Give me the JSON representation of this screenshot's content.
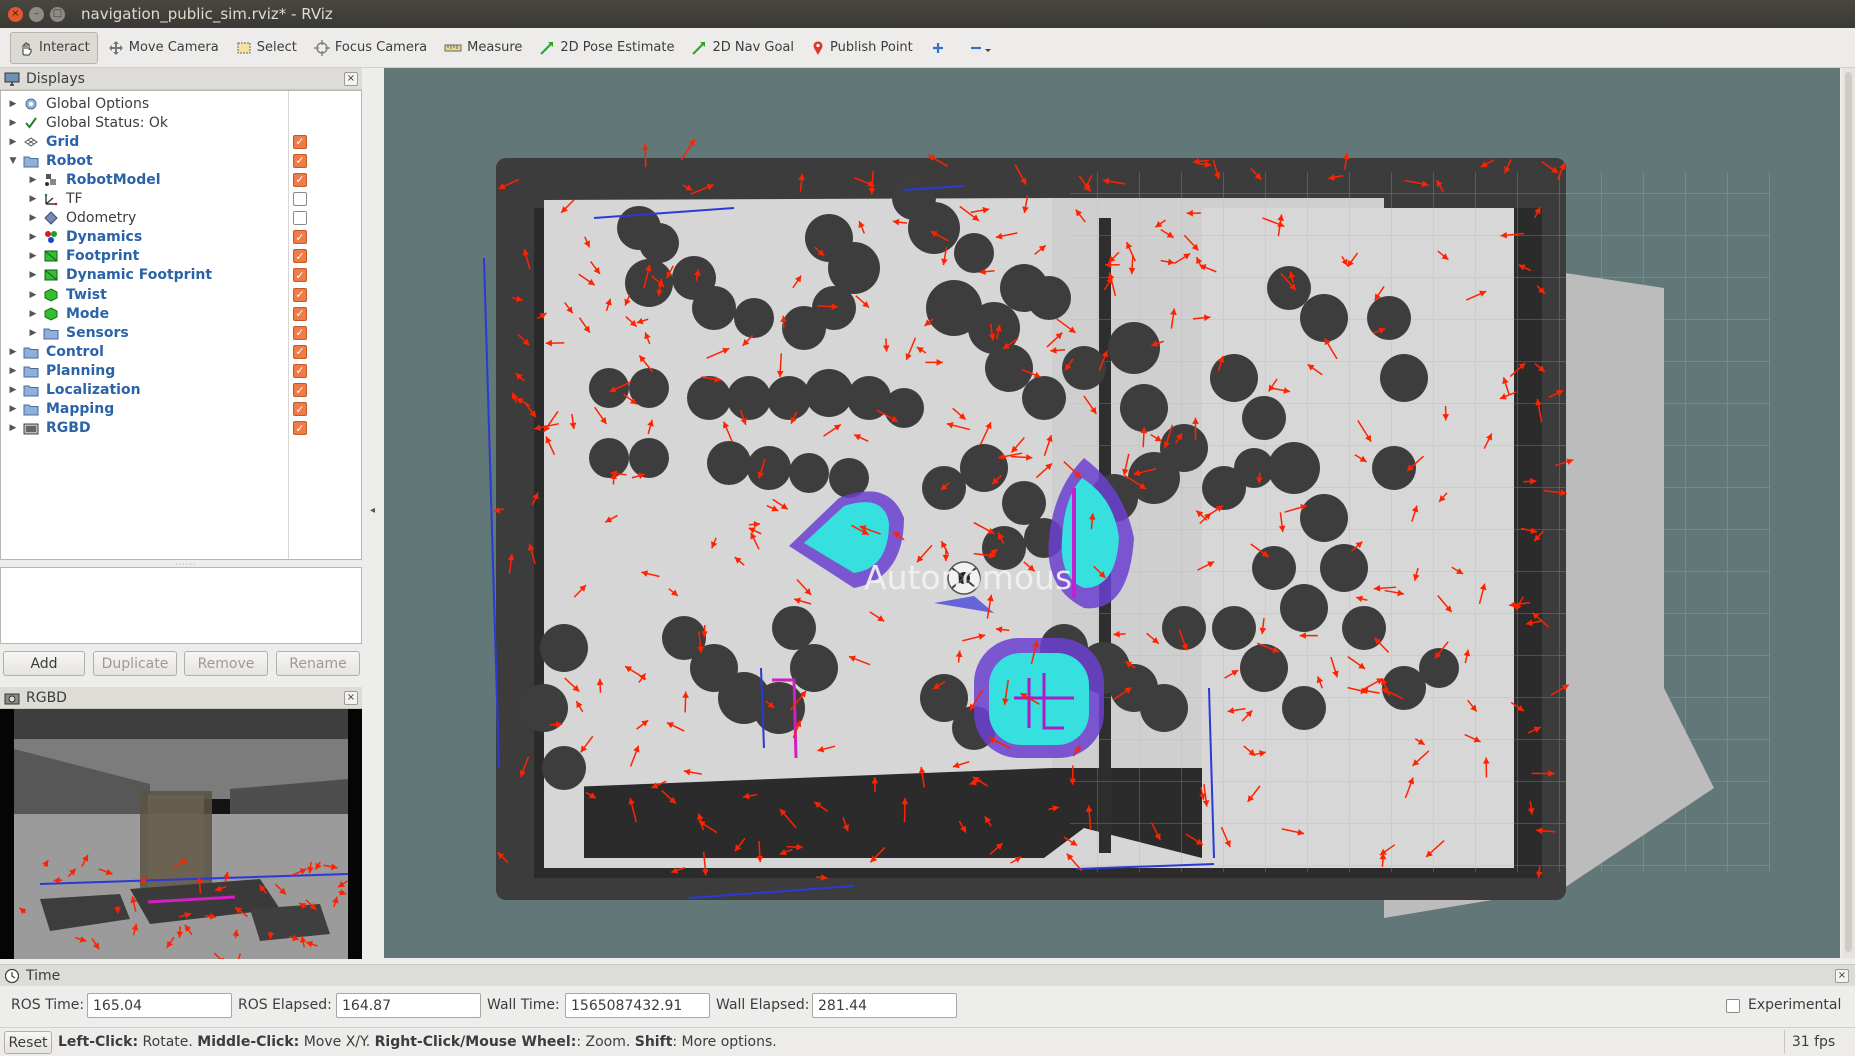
{
  "window": {
    "title": "navigation_public_sim.rviz* - RViz"
  },
  "toolbar": {
    "tools": [
      {
        "label": "Interact",
        "icon": "hand-cursor-icon"
      },
      {
        "label": "Move Camera",
        "icon": "move-arrows-icon"
      },
      {
        "label": "Select",
        "icon": "select-box-icon"
      },
      {
        "label": "Focus Camera",
        "icon": "crosshair-icon"
      },
      {
        "label": "Measure",
        "icon": "ruler-icon"
      },
      {
        "label": "2D Pose Estimate",
        "icon": "green-arrow-icon"
      },
      {
        "label": "2D Nav Goal",
        "icon": "green-arrow-icon"
      },
      {
        "label": "Publish Point",
        "icon": "map-pin-icon"
      }
    ]
  },
  "displays": {
    "title": "Displays",
    "items": [
      {
        "label": "Global Options",
        "checked": null
      },
      {
        "label": "Global Status: Ok",
        "checked": null
      },
      {
        "label": "Grid",
        "checked": true
      },
      {
        "label": "Robot",
        "checked": true
      },
      {
        "label": "RobotModel",
        "checked": true
      },
      {
        "label": "TF",
        "checked": false
      },
      {
        "label": "Odometry",
        "checked": false
      },
      {
        "label": "Dynamics",
        "checked": true
      },
      {
        "label": "Footprint",
        "checked": true
      },
      {
        "label": "Dynamic Footprint",
        "checked": true
      },
      {
        "label": "Twist",
        "checked": true
      },
      {
        "label": "Mode",
        "checked": true
      },
      {
        "label": "Sensors",
        "checked": true
      },
      {
        "label": "Control",
        "checked": true
      },
      {
        "label": "Planning",
        "checked": true
      },
      {
        "label": "Localization",
        "checked": true
      },
      {
        "label": "Mapping",
        "checked": true
      },
      {
        "label": "RGBD",
        "checked": true
      }
    ],
    "buttons": {
      "add": "Add",
      "duplicate": "Duplicate",
      "remove": "Remove",
      "rename": "Rename"
    }
  },
  "rgbd_panel": {
    "title": "RGBD"
  },
  "view3d": {
    "overlay_text": "Autonomous"
  },
  "time": {
    "title": "Time",
    "ros_time_label": "ROS Time:",
    "ros_time": "165.04",
    "ros_elapsed_label": "ROS Elapsed:",
    "ros_elapsed": "164.87",
    "wall_time_label": "Wall Time:",
    "wall_time": "1565087432.91",
    "wall_elapsed_label": "Wall Elapsed:",
    "wall_elapsed": "281.44",
    "experimental_label": "Experimental"
  },
  "status": {
    "reset": "Reset",
    "help": [
      {
        "key": "Left-Click:",
        "action": " Rotate. "
      },
      {
        "key": "Middle-Click:",
        "action": " Move X/Y. "
      },
      {
        "key": "Right-Click/Mouse Wheel:",
        "action": ": Zoom. "
      },
      {
        "key": "Shift",
        "action": ": More options."
      }
    ],
    "fps": "31 fps"
  },
  "colors": {
    "map_free": "#d4d4d4",
    "map_obstacle": "#3c3c3c",
    "background": "#627777",
    "costmap_cyan": "#35e0de",
    "costmap_purple": "#6a3fd0",
    "particle_red": "#ff2200",
    "check_orange": "#ef7b48"
  }
}
